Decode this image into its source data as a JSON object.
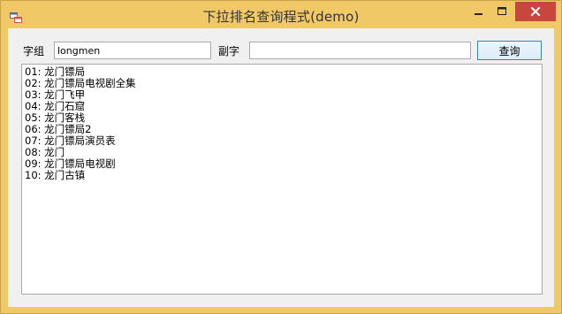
{
  "window": {
    "title": "下拉排名查询程式(demo)",
    "minimize_glyph": "—",
    "maximize_glyph": "□",
    "close_glyph": "✕"
  },
  "form": {
    "word_group_label": "字组",
    "word_group_value": "longmen",
    "subword_label": "副字",
    "subword_value": "",
    "query_button_label": "查询"
  },
  "results": [
    "01: 龙门镖局",
    "02: 龙门镖局电视剧全集",
    "03: 龙门飞甲",
    "04: 龙门石窟",
    "05: 龙门客栈",
    "06: 龙门镖局2",
    "07: 龙门镖局演员表",
    "08: 龙门",
    "09: 龙门镖局电视剧",
    "10: 龙门古镇"
  ],
  "colors": {
    "frame": "#f0c866",
    "close_button": "#c7473f",
    "client_background": "#f0f0f0",
    "button_border": "#3c7fb1"
  },
  "icons": {
    "app": "app-window-icon",
    "minimize": "minimize-icon",
    "maximize": "maximize-icon",
    "close": "close-icon"
  }
}
